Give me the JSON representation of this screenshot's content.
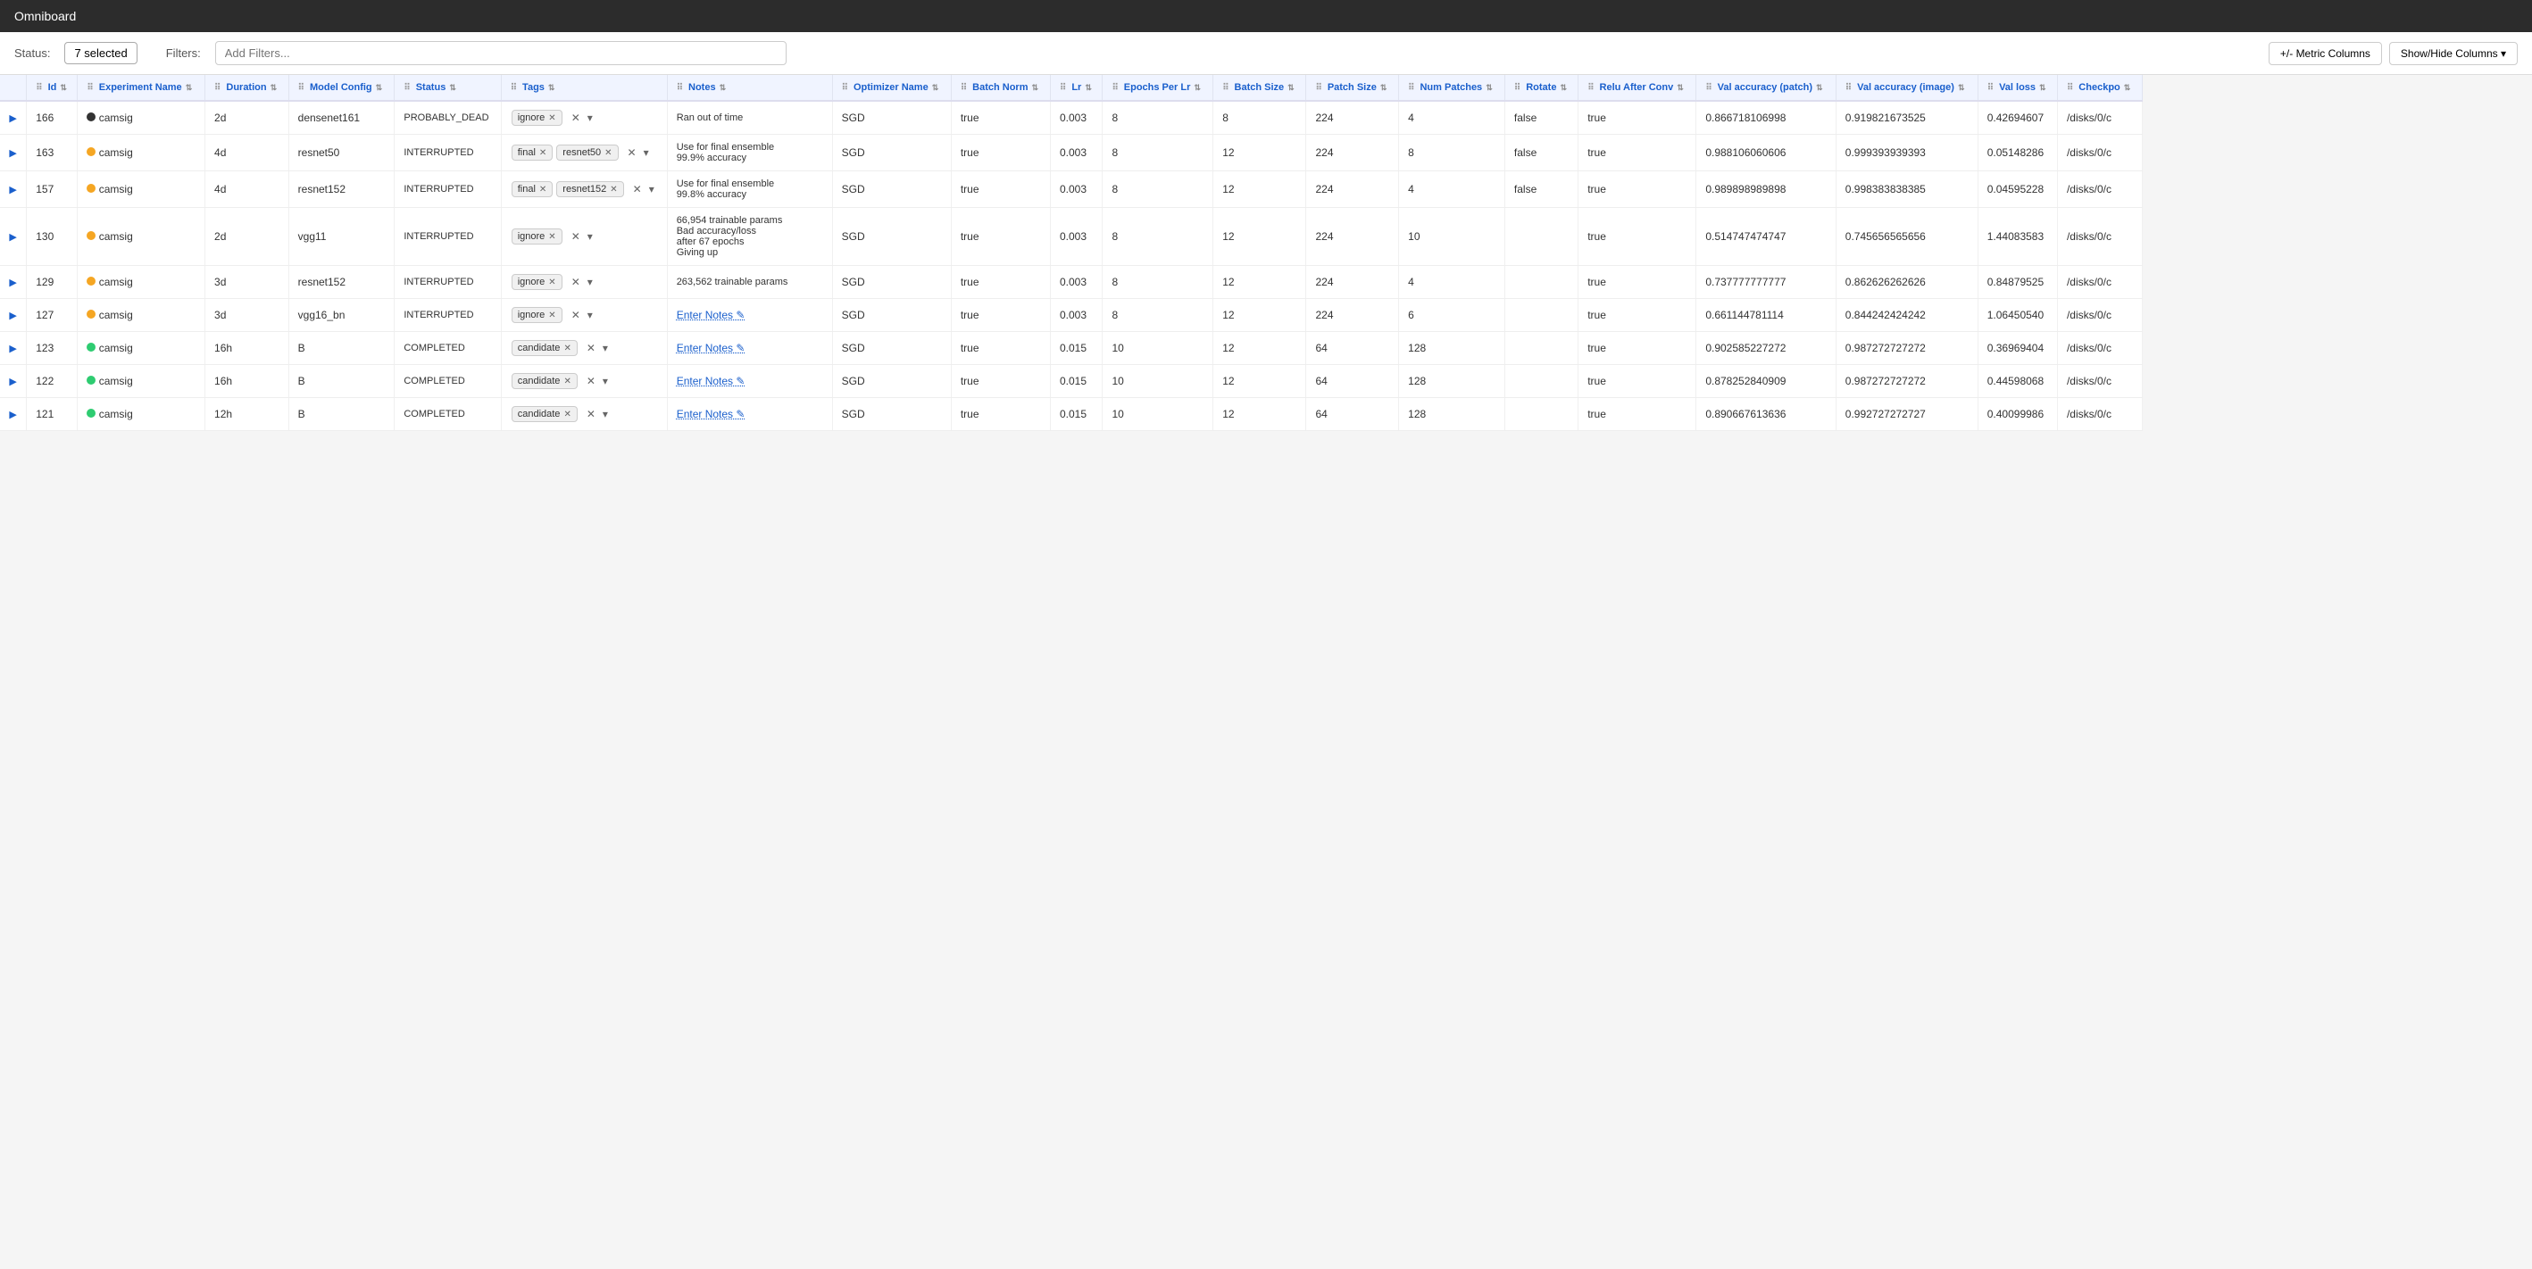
{
  "app": {
    "title": "Omniboard"
  },
  "toolbar": {
    "status_label": "Status:",
    "selected_label": "7 selected",
    "filters_label": "Filters:",
    "filters_placeholder": "Add Filters...",
    "metric_columns_btn": "+/- Metric Columns",
    "show_hide_btn": "Show/Hide Columns ▾"
  },
  "table": {
    "headers": [
      {
        "key": "id",
        "label": "Id"
      },
      {
        "key": "exp_name",
        "label": "Experiment Name"
      },
      {
        "key": "duration",
        "label": "Duration"
      },
      {
        "key": "model_config",
        "label": "Model Config"
      },
      {
        "key": "status",
        "label": "Status"
      },
      {
        "key": "tags",
        "label": "Tags"
      },
      {
        "key": "notes",
        "label": "Notes"
      },
      {
        "key": "optimizer",
        "label": "Optimizer Name"
      },
      {
        "key": "batch_norm",
        "label": "Batch Norm"
      },
      {
        "key": "lr",
        "label": "Lr"
      },
      {
        "key": "epochs_per_lr",
        "label": "Epochs Per Lr"
      },
      {
        "key": "batch_size",
        "label": "Batch Size"
      },
      {
        "key": "patch_size",
        "label": "Patch Size"
      },
      {
        "key": "num_patches",
        "label": "Num Patches"
      },
      {
        "key": "rotate",
        "label": "Rotate"
      },
      {
        "key": "relu_after_conv",
        "label": "Relu After Conv"
      },
      {
        "key": "val_acc_patch",
        "label": "Val accuracy (patch)"
      },
      {
        "key": "val_acc_image",
        "label": "Val accuracy (image)"
      },
      {
        "key": "val_loss",
        "label": "Val loss"
      },
      {
        "key": "checkpoint",
        "label": "Checkpo"
      }
    ],
    "rows": [
      {
        "id": 166,
        "exp_name": "camsig",
        "dot_color": "black",
        "duration": "2d",
        "model_config": "densenet161",
        "status": "PROBABLY_DEAD",
        "tags": [
          "ignore"
        ],
        "notes": "Ran out of time",
        "optimizer": "SGD",
        "batch_norm": "true",
        "lr": "0.003",
        "epochs_per_lr": 8,
        "batch_size": 8,
        "patch_size": 224,
        "num_patches": 4,
        "rotate": "false",
        "relu_after_conv": "true",
        "val_acc_patch": "0.866718106998",
        "val_acc_image": "0.919821673525",
        "val_loss": "0.42694607",
        "checkpoint": "/disks/0/c"
      },
      {
        "id": 163,
        "exp_name": "camsig",
        "dot_color": "orange",
        "duration": "4d",
        "model_config": "resnet50",
        "status": "INTERRUPTED",
        "tags": [
          "final",
          "resnet50"
        ],
        "notes": "Use for final ensemble\n99.9% accuracy",
        "optimizer": "SGD",
        "batch_norm": "true",
        "lr": "0.003",
        "epochs_per_lr": 8,
        "batch_size": 12,
        "patch_size": 224,
        "num_patches": 8,
        "rotate": "false",
        "relu_after_conv": "true",
        "val_acc_patch": "0.988106060606",
        "val_acc_image": "0.999393939393",
        "val_loss": "0.05148286",
        "checkpoint": "/disks/0/c"
      },
      {
        "id": 157,
        "exp_name": "camsig",
        "dot_color": "orange",
        "duration": "4d",
        "model_config": "resnet152",
        "status": "INTERRUPTED",
        "tags": [
          "final",
          "resnet152"
        ],
        "notes": "Use for final ensemble\n99.8% accuracy",
        "optimizer": "SGD",
        "batch_norm": "true",
        "lr": "0.003",
        "epochs_per_lr": 8,
        "batch_size": 12,
        "patch_size": 224,
        "num_patches": 4,
        "rotate": "false",
        "relu_after_conv": "true",
        "val_acc_patch": "0.989898989898",
        "val_acc_image": "0.998383838385",
        "val_loss": "0.04595228",
        "checkpoint": "/disks/0/c"
      },
      {
        "id": 130,
        "exp_name": "camsig",
        "dot_color": "orange",
        "duration": "2d",
        "model_config": "vgg11",
        "status": "INTERRUPTED",
        "tags": [
          "ignore"
        ],
        "notes": "66,954 trainable params\nBad accuracy/loss\nafter 67 epochs\nGiving up",
        "optimizer": "SGD",
        "batch_norm": "true",
        "lr": "0.003",
        "epochs_per_lr": 8,
        "batch_size": 12,
        "patch_size": 224,
        "num_patches": 10,
        "rotate": "",
        "relu_after_conv": "true",
        "val_acc_patch": "0.514747474747",
        "val_acc_image": "0.745656565656",
        "val_loss": "1.44083583",
        "checkpoint": "/disks/0/c"
      },
      {
        "id": 129,
        "exp_name": "camsig",
        "dot_color": "orange",
        "duration": "3d",
        "model_config": "resnet152",
        "status": "INTERRUPTED",
        "tags": [
          "ignore"
        ],
        "notes": "263,562 trainable params",
        "optimizer": "SGD",
        "batch_norm": "true",
        "lr": "0.003",
        "epochs_per_lr": 8,
        "batch_size": 12,
        "patch_size": 224,
        "num_patches": 4,
        "rotate": "",
        "relu_after_conv": "true",
        "val_acc_patch": "0.737777777777",
        "val_acc_image": "0.862626262626",
        "val_loss": "0.84879525",
        "checkpoint": "/disks/0/c"
      },
      {
        "id": 127,
        "exp_name": "camsig",
        "dot_color": "orange",
        "duration": "3d",
        "model_config": "vgg16_bn",
        "status": "INTERRUPTED",
        "tags": [
          "ignore"
        ],
        "notes": "",
        "notes_placeholder": "Enter Notes",
        "optimizer": "SGD",
        "batch_norm": "true",
        "lr": "0.003",
        "epochs_per_lr": 8,
        "batch_size": 12,
        "patch_size": 224,
        "num_patches": 6,
        "rotate": "",
        "relu_after_conv": "true",
        "val_acc_patch": "0.661144781114",
        "val_acc_image": "0.844242424242",
        "val_loss": "1.06450540",
        "checkpoint": "/disks/0/c"
      },
      {
        "id": 123,
        "exp_name": "camsig",
        "dot_color": "green",
        "duration": "16h",
        "model_config": "B",
        "status": "COMPLETED",
        "tags": [
          "candidate"
        ],
        "notes": "",
        "notes_placeholder": "Enter Notes",
        "optimizer": "SGD",
        "batch_norm": "true",
        "lr": "0.015",
        "epochs_per_lr": 10,
        "batch_size": 12,
        "patch_size": 64,
        "num_patches": 128,
        "rotate": "",
        "relu_after_conv": "true",
        "val_acc_patch": "0.902585227272",
        "val_acc_image": "0.987272727272",
        "val_loss": "0.36969404",
        "checkpoint": "/disks/0/c"
      },
      {
        "id": 122,
        "exp_name": "camsig",
        "dot_color": "green",
        "duration": "16h",
        "model_config": "B",
        "status": "COMPLETED",
        "tags": [
          "candidate"
        ],
        "notes": "",
        "notes_placeholder": "Enter Notes",
        "optimizer": "SGD",
        "batch_norm": "true",
        "lr": "0.015",
        "epochs_per_lr": 10,
        "batch_size": 12,
        "patch_size": 64,
        "num_patches": 128,
        "rotate": "",
        "relu_after_conv": "true",
        "val_acc_patch": "0.878252840909",
        "val_acc_image": "0.987272727272",
        "val_loss": "0.44598068",
        "checkpoint": "/disks/0/c"
      },
      {
        "id": 121,
        "exp_name": "camsig",
        "dot_color": "green",
        "duration": "12h",
        "model_config": "B",
        "status": "COMPLETED",
        "tags": [
          "candidate"
        ],
        "notes": "",
        "notes_placeholder": "Enter Notes",
        "optimizer": "SGD",
        "batch_norm": "true",
        "lr": "0.015",
        "epochs_per_lr": 10,
        "batch_size": 12,
        "patch_size": 64,
        "num_patches": 128,
        "rotate": "",
        "relu_after_conv": "true",
        "val_acc_patch": "0.890667613636",
        "val_acc_image": "0.992727272727",
        "val_loss": "0.40099986",
        "checkpoint": "/disks/0/c"
      }
    ]
  }
}
